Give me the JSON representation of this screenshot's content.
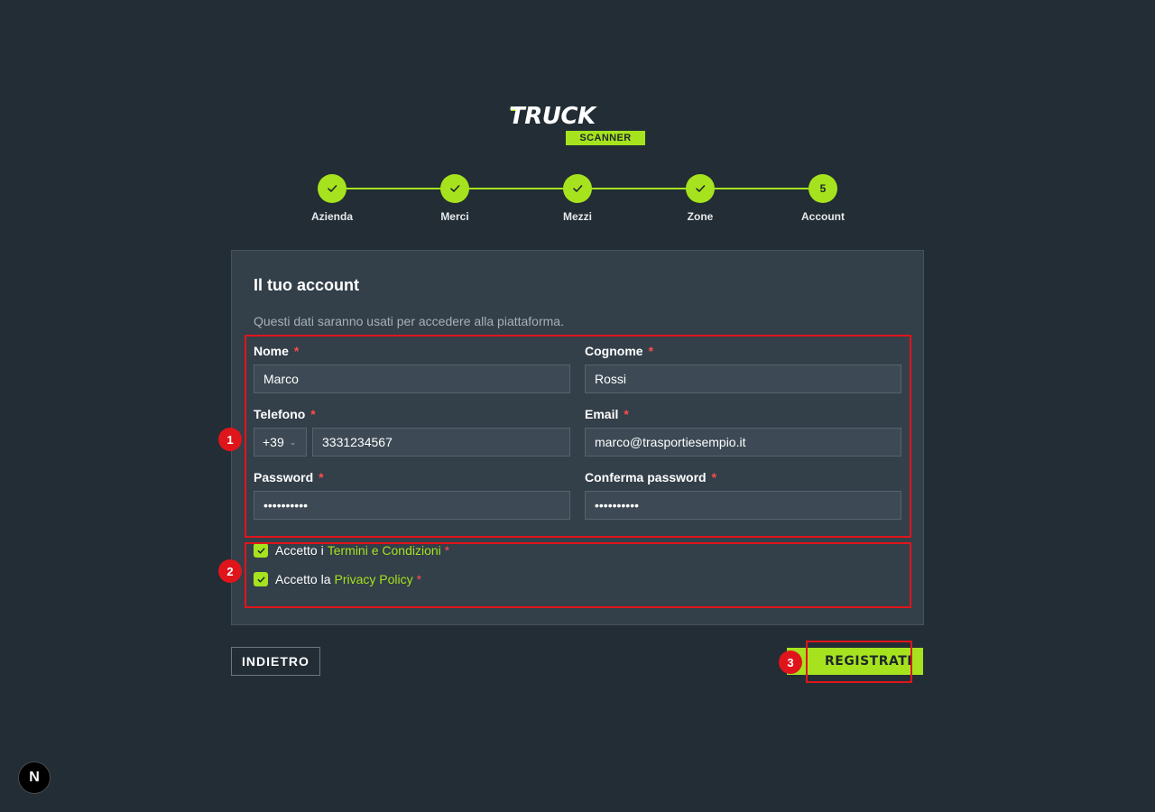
{
  "logo": {
    "main": "TRUCK",
    "sub": "SCANNER"
  },
  "colors": {
    "accent": "#a6e31e",
    "background": "#222d35",
    "card": "#333f49",
    "required": "#ff4d4d",
    "annotation": "#e0151b"
  },
  "stepper": {
    "steps": [
      {
        "label": "Azienda",
        "state": "completed",
        "icon": "check-icon"
      },
      {
        "label": "Merci",
        "state": "completed",
        "icon": "check-icon"
      },
      {
        "label": "Mezzi",
        "state": "completed",
        "icon": "check-icon"
      },
      {
        "label": "Zone",
        "state": "completed",
        "icon": "check-icon"
      },
      {
        "label": "Account",
        "state": "current",
        "number": "5"
      }
    ]
  },
  "card": {
    "title": "Il tuo account",
    "subtitle": "Questi dati saranno usati per accedere alla piattaforma."
  },
  "form": {
    "required_mark": "*",
    "nome": {
      "label": "Nome",
      "value": "Marco"
    },
    "cognome": {
      "label": "Cognome",
      "value": "Rossi"
    },
    "telefono": {
      "label": "Telefono",
      "prefix": "+39",
      "value": "3331234567"
    },
    "email": {
      "label": "Email",
      "value": "marco@trasportiesempio.it"
    },
    "password": {
      "label": "Password",
      "value": "••••••••••"
    },
    "conferma_password": {
      "label": "Conferma password",
      "value": "••••••••••"
    }
  },
  "consents": {
    "terms": {
      "checked": true,
      "text": "Accetto i",
      "link": "Termini e Condizioni",
      "required": "*"
    },
    "privacy": {
      "checked": true,
      "text": "Accetto la",
      "link": "Privacy Policy",
      "required": "*"
    }
  },
  "actions": {
    "back_label": "INDIETRO",
    "submit_label": "REGISTRATI"
  },
  "annotations": [
    "1",
    "2",
    "3"
  ],
  "dev_indicator": {
    "label": "N"
  }
}
